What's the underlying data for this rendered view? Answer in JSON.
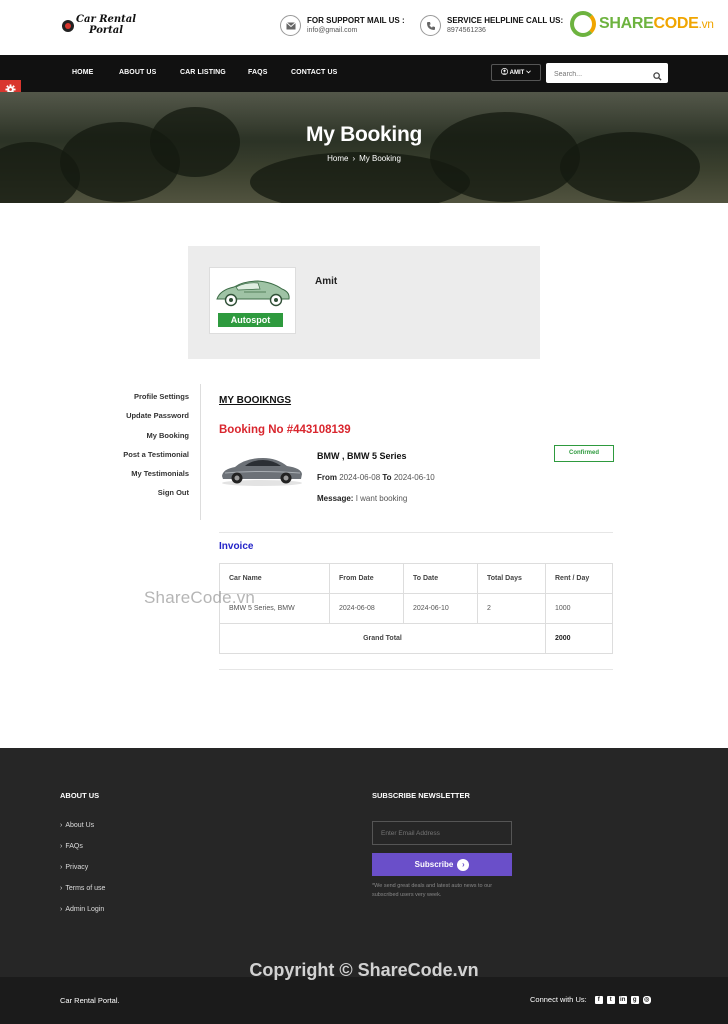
{
  "header": {
    "logo_line1": "Car Rental",
    "logo_line2": "Portal",
    "mail_title": "FOR SUPPORT MAIL US :",
    "mail_value": "info@gmail.com",
    "phone_title": "SERVICE HELPLINE CALL US:",
    "phone_value": "8974561236",
    "brand_a": "SHARE",
    "brand_b": "CODE",
    "brand_domain": ".vn"
  },
  "nav": {
    "items": [
      "HOME",
      "ABOUT US",
      "CAR LISTING",
      "FAQS",
      "CONTACT US"
    ],
    "user_label": "AMIT",
    "search_placeholder": "Search..."
  },
  "banner": {
    "title": "My Booking",
    "crumb_home": "Home",
    "crumb_current": "My Booking"
  },
  "profile": {
    "name": "Amit",
    "image_tag": "Autospot"
  },
  "sidebar": {
    "items": [
      "Profile Settings",
      "Update Password",
      "My Booking",
      "Post a Testimonial",
      "My Testimonials",
      "Sign Out"
    ]
  },
  "bookings": {
    "section_title": "MY BOOIKNGS",
    "booking_no": "Booking No #443108139",
    "car_model": "BMW , BMW 5 Series",
    "from_label": "From",
    "from_date": "2024-06-08",
    "to_label": "To",
    "to_date": "2024-06-10",
    "message_label": "Message:",
    "message": "I want booking",
    "status": "Confirmed"
  },
  "invoice": {
    "title": "Invoice",
    "headers": [
      "Car Name",
      "From Date",
      "To Date",
      "Total Days",
      "Rent / Day"
    ],
    "row": [
      "BMW 5 Series, BMW",
      "2024-06-08",
      "2024-06-10",
      "2",
      "1000"
    ],
    "grand_total_label": "Grand Total",
    "grand_total_value": "2000"
  },
  "footer": {
    "about_title": "ABOUT US",
    "links": [
      "About Us",
      "FAQs",
      "Privacy",
      "Terms of use",
      "Admin Login"
    ],
    "newsletter_title": "SUBSCRIBE NEWSLETTER",
    "email_placeholder": "Enter Email Address",
    "subscribe_label": "Subscribe",
    "note": "*We send great deals and latest auto news to our subscribed users very week.",
    "copyright_name": "Car Rental Portal.",
    "connect_label": "Connect with Us:"
  },
  "watermarks": {
    "mid": "ShareCode.vn",
    "bottom": "Copyright © ShareCode.vn"
  },
  "colors": {
    "accent_red": "#d9262e",
    "nav_bg": "#111111",
    "invoice_blue": "#2323c8",
    "confirmed_green": "#2e9a3e",
    "subscribe_purple": "#6a4fc9",
    "footer_bg": "#262626"
  }
}
